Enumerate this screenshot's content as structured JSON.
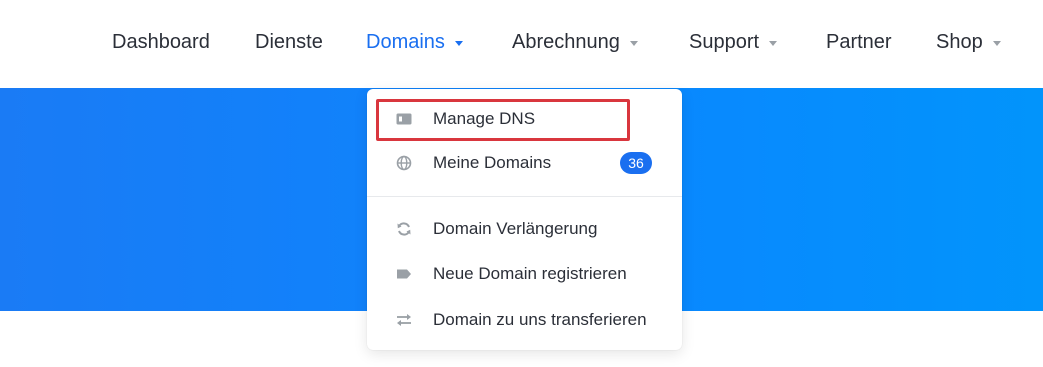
{
  "nav": {
    "items": [
      {
        "label": "Dashboard"
      },
      {
        "label": "Dienste"
      },
      {
        "label": "Domains"
      },
      {
        "label": "Abrechnung"
      },
      {
        "label": "Support"
      },
      {
        "label": "Partner"
      },
      {
        "label": "Shop"
      }
    ],
    "active_item": "Domains"
  },
  "dropdown": {
    "items": [
      {
        "label": "Manage DNS",
        "icon": "id-card-icon",
        "highlighted": true
      },
      {
        "label": "Meine Domains",
        "icon": "globe-icon",
        "badge": "36"
      },
      {
        "label": "Domain Verlängerung",
        "icon": "refresh-icon"
      },
      {
        "label": "Neue Domain registrieren",
        "icon": "tag-icon"
      },
      {
        "label": "Domain zu uns transferieren",
        "icon": "transfer-icon"
      }
    ]
  },
  "colors": {
    "accent": "#1a6ff0",
    "hero_start": "#1a7bf5",
    "hero_end": "#0294fb",
    "highlight_box": "#d9363e",
    "icon_gray": "#9aa0a6",
    "text": "#2b2f38"
  }
}
